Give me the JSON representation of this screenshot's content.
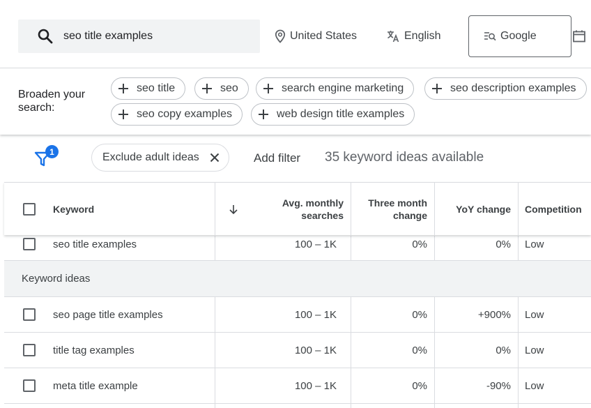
{
  "search": {
    "query": "seo title examples"
  },
  "targeting": {
    "location": "United States",
    "language": "English",
    "network": "Google"
  },
  "broaden": {
    "label_line1": "Broaden your",
    "label_line2": "search:",
    "chips": [
      "seo title",
      "seo",
      "search engine marketing",
      "seo description examples",
      "seo copy examples",
      "web design title examples"
    ]
  },
  "filters": {
    "badge_count": "1",
    "active_filter": "Exclude adult ideas",
    "add_filter_label": "Add filter",
    "ideas_available": "35 keyword ideas available"
  },
  "table": {
    "headers": {
      "keyword": "Keyword",
      "avg_monthly_line1": "Avg. monthly",
      "avg_monthly_line2": "searches",
      "three_month_line1": "Three month",
      "three_month_line2": "change",
      "yoy": "YoY change",
      "competition": "Competition"
    },
    "provided_keyword": {
      "keyword": "seo title examples",
      "avg": "100 – 1K",
      "three_month": "0%",
      "yoy": "0%",
      "competition": "Low"
    },
    "section_label": "Keyword ideas",
    "rows": [
      {
        "keyword": "seo page title examples",
        "avg": "100 – 1K",
        "three_month": "0%",
        "yoy": "+900%",
        "competition": "Low"
      },
      {
        "keyword": "title tag examples",
        "avg": "100 – 1K",
        "three_month": "0%",
        "yoy": "0%",
        "competition": "Low"
      },
      {
        "keyword": "meta title example",
        "avg": "100 – 1K",
        "three_month": "0%",
        "yoy": "-90%",
        "competition": "Low"
      }
    ]
  },
  "colors": {
    "accent": "#1a73e8",
    "border": "#dadce0",
    "section_bg": "#f1f3f4",
    "text": "#3c4043"
  }
}
